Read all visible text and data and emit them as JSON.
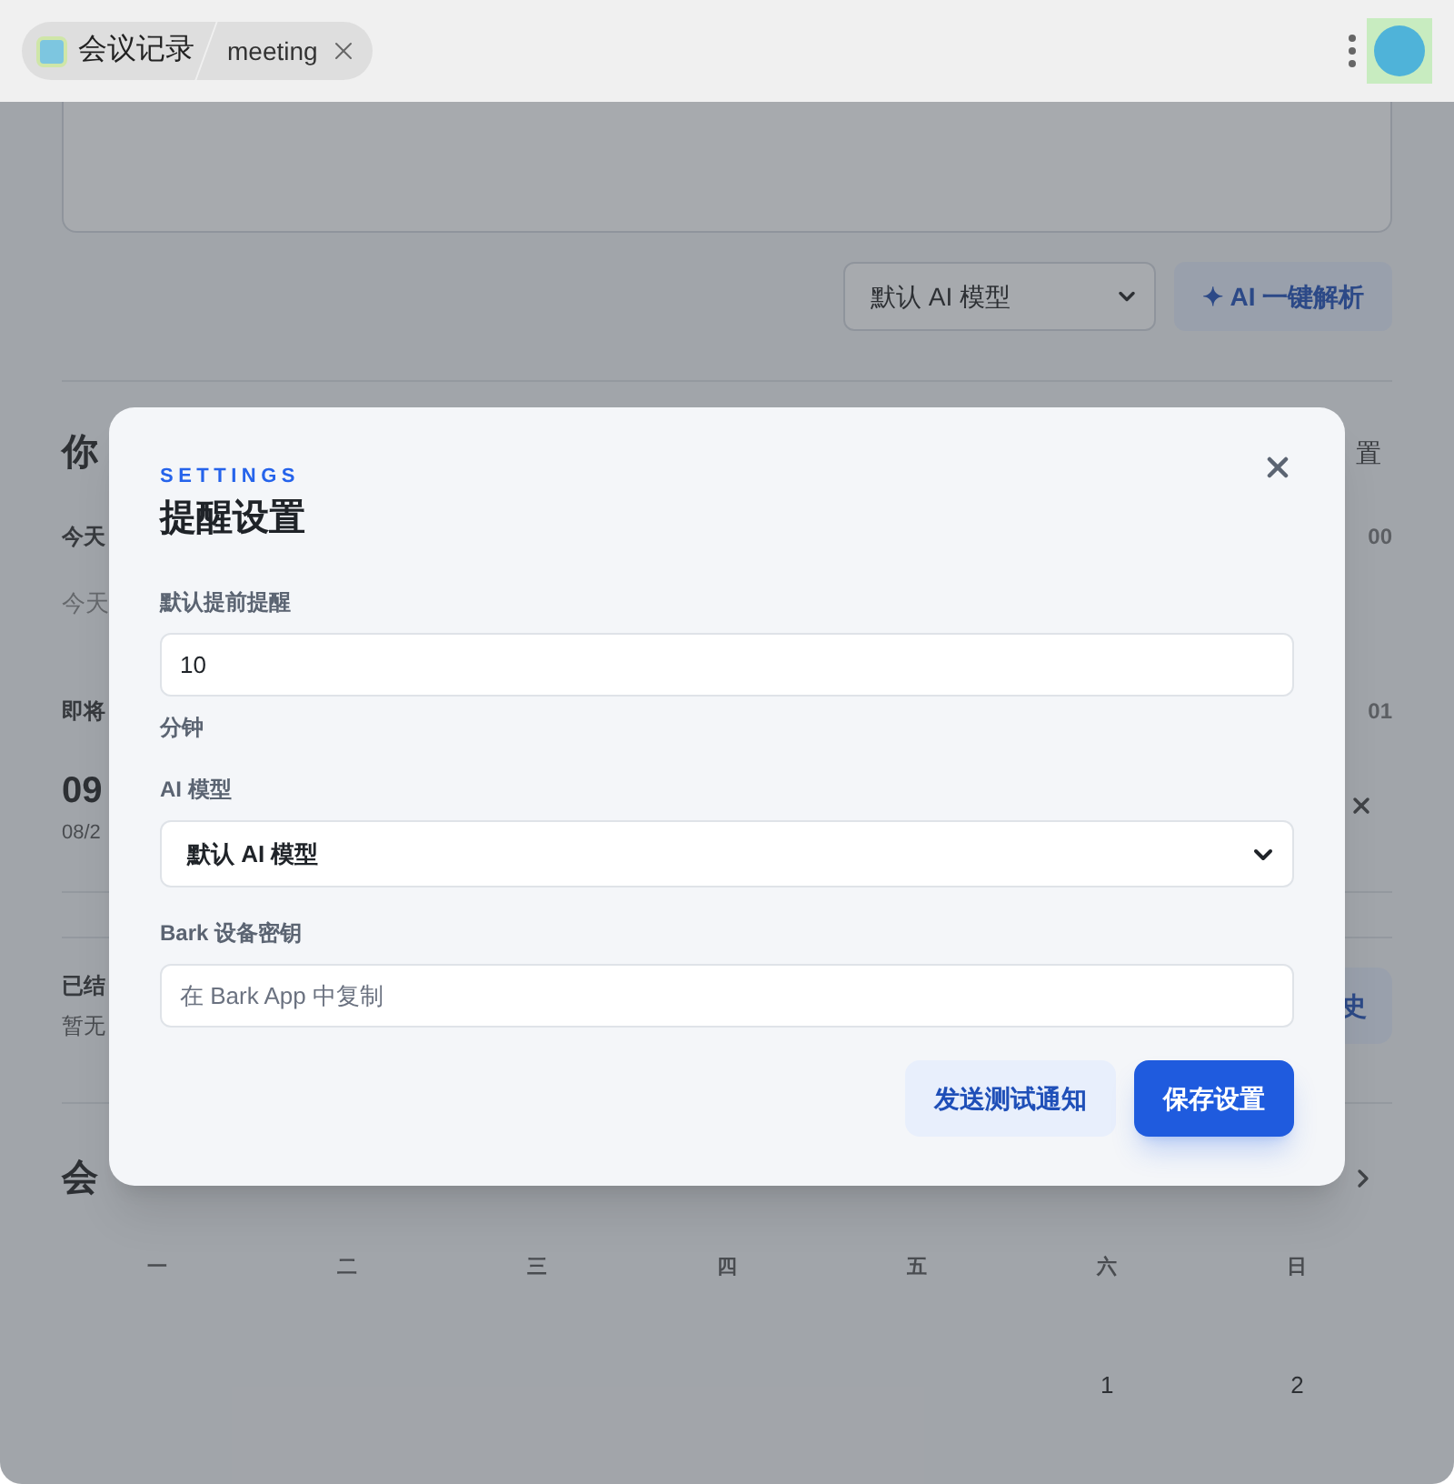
{
  "tab_bar": {
    "app_title": "会议记录",
    "tab": "meeting"
  },
  "page": {
    "model_select": "默认 AI 模型",
    "analyze_button": "✦ AI 一键解析",
    "section_heading": "你",
    "section_action": "置",
    "today_label": "今天",
    "today_count": "00",
    "today_empty": "今天",
    "upcoming_label": "即将",
    "upcoming_count": "01",
    "meeting_time": "09",
    "meeting_date": "08/2",
    "ended_label": "已结",
    "ended_empty": "暂无",
    "history_button": "史",
    "calendar_heading": "会",
    "weekdays": [
      "一",
      "二",
      "三",
      "四",
      "五",
      "六",
      "日"
    ],
    "days": [
      "1",
      "2"
    ]
  },
  "dialog": {
    "eyebrow": "SETTINGS",
    "title": "提醒设置",
    "fields": [
      {
        "kind": "input",
        "label": "默认提前提醒",
        "value": "10",
        "hint": "分钟"
      },
      {
        "kind": "select",
        "label": "AI 模型",
        "value": "默认 AI 模型"
      },
      {
        "kind": "input",
        "label": "Bark 设备密钥",
        "placeholder": "在 Bark App 中复制"
      }
    ],
    "buttons": [
      {
        "label": "发送测试通知",
        "primary": false
      },
      {
        "label": "保存设置",
        "primary": true
      }
    ]
  }
}
